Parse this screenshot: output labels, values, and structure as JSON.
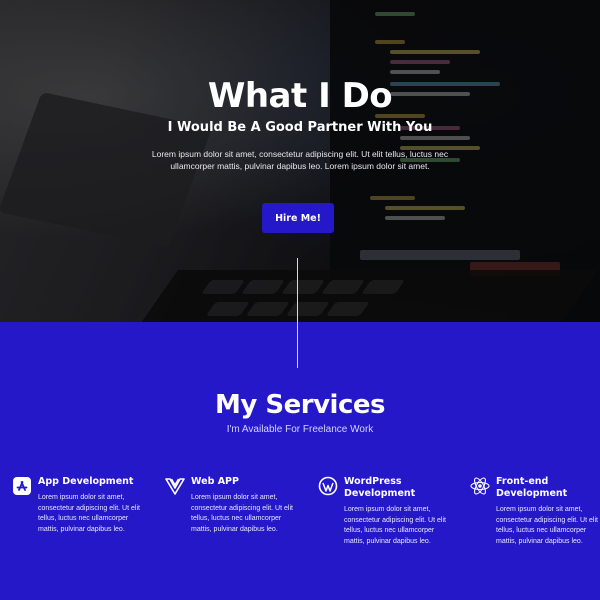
{
  "hero": {
    "title": "What I Do",
    "subtitle": "I Would Be A Good Partner With You",
    "text": "Lorem ipsum dolor sit amet, consectetur adipiscing elit. Ut elit tellus, luctus nec ullamcorper mattis, pulvinar dapibus leo. Lorem ipsum dolor sit amet.",
    "button_label": "Hire Me!"
  },
  "services": {
    "title": "My Services",
    "subtitle": "I'm Available For Freelance Work",
    "items": [
      {
        "title": "App Development",
        "icon": "app-store-icon",
        "text": "Lorem ipsum dolor sit amet, consectetur adipiscing elit. Ut elit tellus, luctus nec ullamcorper mattis, pulvinar dapibus leo."
      },
      {
        "title": "Web APP",
        "icon": "vue-icon",
        "text": "Lorem ipsum dolor sit amet, consectetur adipiscing elit. Ut elit tellus, luctus nec ullamcorper mattis, pulvinar dapibus leo."
      },
      {
        "title": "WordPress Development",
        "icon": "wordpress-icon",
        "text": "Lorem ipsum dolor sit amet, consectetur adipiscing elit. Ut elit tellus, luctus nec ullamcorper mattis, pulvinar dapibus leo."
      },
      {
        "title": "Front-end Development",
        "icon": "react-icon",
        "text": "Lorem ipsum dolor sit amet, consectetur adipiscing elit. Ut elit tellus, luctus nec ullamcorper mattis, pulvinar dapibus leo."
      }
    ]
  },
  "colors": {
    "accent": "#2418c9",
    "hero_dark": "#1a1a1e",
    "text": "#ffffff"
  }
}
